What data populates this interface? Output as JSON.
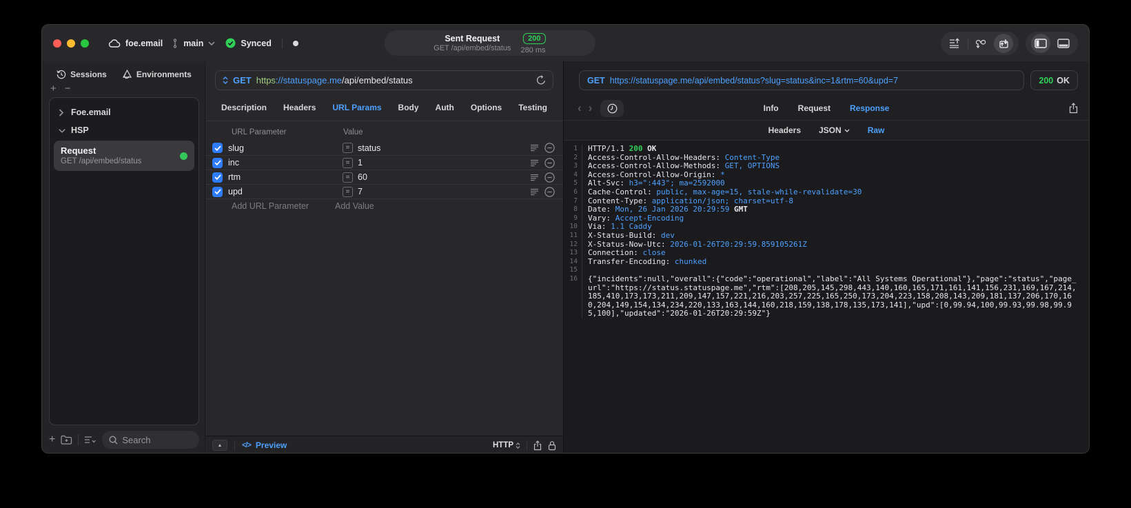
{
  "titlebar": {
    "project": "foe.email",
    "branch": "main",
    "sync_status": "Synced",
    "request_title": "Sent Request",
    "request_subtitle": "GET /api/embed/status",
    "status_code": "200",
    "duration": "280 ms"
  },
  "colors": {
    "accent_blue": "#4da0ff",
    "status_green": "#30d158",
    "checkbox_blue": "#2e7cf7",
    "scheme_green": "#9fcb7f"
  },
  "icons": {
    "plus": "+",
    "minus": "−",
    "nav_back": "‹",
    "nav_forward": "›",
    "code_slash": "</>",
    "drawer_up": "▲",
    "equals": "="
  },
  "sidebar": {
    "tabs": [
      {
        "label": "Sessions"
      },
      {
        "label": "Environments"
      }
    ],
    "tree": {
      "group1": "Foe.email",
      "group2": "HSP"
    },
    "request_item": {
      "title": "Request",
      "subtitle": "GET /api/embed/status"
    },
    "search_placeholder": "Search"
  },
  "request_panel": {
    "method": "GET",
    "url_scheme": "https",
    "url_host": "://statuspage.me",
    "url_path": "/api/embed/status",
    "tabs": [
      "Description",
      "Headers",
      "URL Params",
      "Body",
      "Auth",
      "Options",
      "Testing"
    ],
    "active_tab": "URL Params",
    "param_table": {
      "columns": [
        "URL Parameter",
        "Value"
      ],
      "operator": "=",
      "rows": [
        {
          "name": "slug",
          "value": "status",
          "enabled": true
        },
        {
          "name": "inc",
          "value": "1",
          "enabled": true
        },
        {
          "name": "rtm",
          "value": "60",
          "enabled": true
        },
        {
          "name": "upd",
          "value": "7",
          "enabled": true
        }
      ],
      "add_param_placeholder": "Add URL Parameter",
      "add_value_placeholder": "Add Value"
    },
    "footer": {
      "preview_label": "Preview",
      "protocol": "HTTP"
    }
  },
  "response_panel": {
    "method": "GET",
    "url": "https://statuspage.me/api/embed/status?slug=status&inc=1&rtm=60&upd=7",
    "status_code": "200",
    "status_text": "OK",
    "tabs": [
      {
        "label": "Info"
      },
      {
        "label": "Request"
      },
      {
        "label": "Response",
        "active": true
      }
    ],
    "subtabs": [
      {
        "label": "Headers"
      },
      {
        "label": "JSON",
        "dropdown": true
      },
      {
        "label": "Raw",
        "active": true
      }
    ],
    "lines": [
      {
        "segments": [
          {
            "t": "HTTP/1.1 "
          },
          {
            "t": "200",
            "c": "green"
          },
          {
            "t": " OK",
            "c": "bold"
          }
        ]
      },
      {
        "segments": [
          {
            "t": "Access-Control-Allow-Headers: "
          },
          {
            "t": "Content-Type",
            "c": "blue"
          }
        ]
      },
      {
        "segments": [
          {
            "t": "Access-Control-Allow-Methods: "
          },
          {
            "t": "GET, OPTIONS",
            "c": "blue"
          }
        ]
      },
      {
        "segments": [
          {
            "t": "Access-Control-Allow-Origin: "
          },
          {
            "t": "*",
            "c": "blue"
          }
        ]
      },
      {
        "segments": [
          {
            "t": "Alt-Svc: "
          },
          {
            "t": "h3=\":443\"; ma=2592000",
            "c": "blue"
          }
        ]
      },
      {
        "segments": [
          {
            "t": "Cache-Control: "
          },
          {
            "t": "public, max-age=15, stale-while-revalidate=30",
            "c": "blue"
          }
        ]
      },
      {
        "segments": [
          {
            "t": "Content-Type: "
          },
          {
            "t": "application/json; charset=utf-8",
            "c": "blue"
          }
        ]
      },
      {
        "segments": [
          {
            "t": "Date: "
          },
          {
            "t": "Mon, 26 Jan 2026 20:29:59",
            "c": "blue"
          },
          {
            "t": " GMT",
            "c": "bold"
          }
        ]
      },
      {
        "segments": [
          {
            "t": "Vary: "
          },
          {
            "t": "Accept-Encoding",
            "c": "blue"
          }
        ]
      },
      {
        "segments": [
          {
            "t": "Via: "
          },
          {
            "t": "1.1 Caddy",
            "c": "blue"
          }
        ]
      },
      {
        "segments": [
          {
            "t": "X-Status-Build: "
          },
          {
            "t": "dev",
            "c": "blue"
          }
        ]
      },
      {
        "segments": [
          {
            "t": "X-Status-Now-Utc: "
          },
          {
            "t": "2026-01-26T20:29:59.859105261Z",
            "c": "blue"
          }
        ]
      },
      {
        "segments": [
          {
            "t": "Connection: "
          },
          {
            "t": "close",
            "c": "blue"
          }
        ]
      },
      {
        "segments": [
          {
            "t": "Transfer-Encoding: "
          },
          {
            "t": "chunked",
            "c": "blue"
          }
        ]
      },
      {
        "segments": []
      },
      {
        "segments": [
          {
            "t": "{\"incidents\":null,\"overall\":{\"code\":\"operational\",\"label\":\"All Systems Operational\"},\"page\":\"status\",\"page_url\":\"https://status.statuspage.me\",\"rtm\":[208,205,145,298,443,140,160,165,171,161,141,156,231,169,167,214,185,410,173,173,211,209,147,157,221,216,203,257,225,165,250,173,204,223,158,208,143,209,181,137,206,170,160,204,149,154,134,234,220,133,163,144,160,218,159,138,178,135,173,141],\"upd\":[0,99.94,100,99.93,99.98,99.95,100],\"updated\":\"2026-01-26T20:29:59Z\"}"
          }
        ]
      }
    ]
  }
}
